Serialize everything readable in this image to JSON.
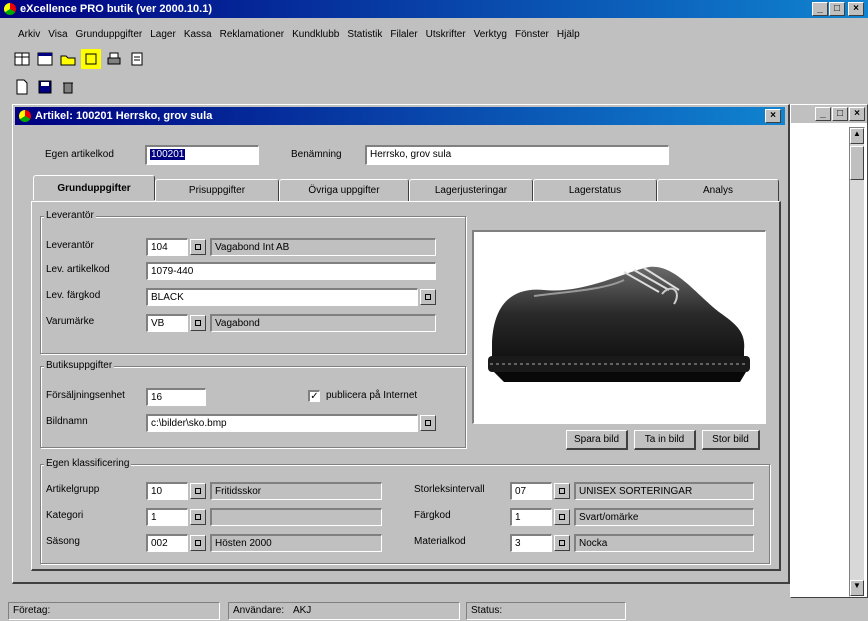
{
  "app": {
    "title": "eXcellence PRO butik (ver 2000.10.1)",
    "menu": [
      "Arkiv",
      "Visa",
      "Grunduppgifter",
      "Lager",
      "Kassa",
      "Reklamationer",
      "Kundklubb",
      "Statistik",
      "Filaler",
      "Utskrifter",
      "Verktyg",
      "Fönster",
      "Hjälp"
    ]
  },
  "window": {
    "title": "Artikel: 100201 Herrsko, grov sula",
    "article_code_label": "Egen artikelkod",
    "article_code_value": "100201",
    "name_label": "Benämning",
    "name_value": "Herrsko, grov sula"
  },
  "tabs": [
    "Grunduppgifter",
    "Prisuppgifter",
    "Övriga uppgifter",
    "Lagerjusteringar",
    "Lagerstatus",
    "Analys"
  ],
  "active_tab": 0,
  "supplier": {
    "group_label": "Leverantör",
    "supplier_label": "Leverantör",
    "supplier_code": "104",
    "supplier_name": "Vagabond Int AB",
    "art_code_label": "Lev. artikelkod",
    "art_code_value": "1079-440",
    "color_label": "Lev. färgkod",
    "color_value": "BLACK",
    "brand_label": "Varumärke",
    "brand_code": "VB",
    "brand_name": "Vagabond"
  },
  "store": {
    "group_label": "Butiksuppgifter",
    "unit_label": "Försäljningsenhet",
    "unit_value": "16",
    "publish_label": "publicera på Internet",
    "publish_checked": true,
    "image_label": "Bildnamn",
    "image_value": "c:\\bilder\\sko.bmp"
  },
  "image_buttons": [
    "Spara bild",
    "Ta in bild",
    "Stor bild"
  ],
  "classification": {
    "group_label": "Egen klassificering",
    "left": [
      {
        "label": "Artikelgrupp",
        "code": "10",
        "name": "Fritidsskor"
      },
      {
        "label": "Kategori",
        "code": "1",
        "name": ""
      },
      {
        "label": "Säsong",
        "code": "002",
        "name": "Hösten 2000"
      }
    ],
    "right": [
      {
        "label": "Storleksintervall",
        "code": "07",
        "name": "UNISEX SORTERINGAR"
      },
      {
        "label": "Färgkod",
        "code": "1",
        "name": "Svart/omärke"
      },
      {
        "label": "Materialkod",
        "code": "3",
        "name": "Nocka"
      }
    ]
  },
  "statusbar": {
    "company_label": "Företag:",
    "company_value": "",
    "user_label": "Användare:",
    "user_value": "AKJ",
    "status_label": "Status:",
    "status_value": ""
  },
  "colors": {
    "title_start": "#000080",
    "title_end": "#1084d0",
    "face": "#c0c0c0",
    "selection": "#000080"
  }
}
